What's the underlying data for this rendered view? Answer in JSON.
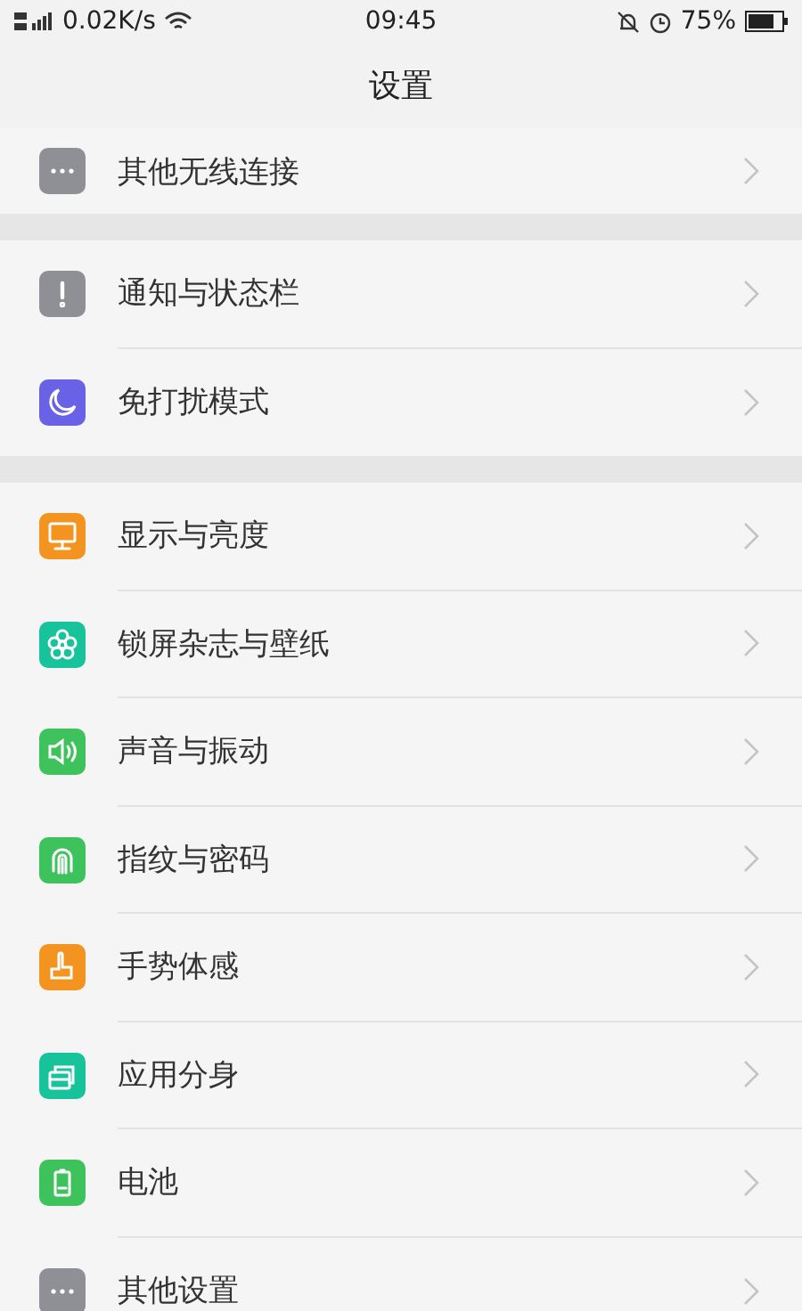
{
  "status_bar": {
    "network": "0.02K/s",
    "time": "09:45",
    "battery": "75%"
  },
  "title": "设置",
  "groups": [
    {
      "items": [
        {
          "label": "其他无线连接",
          "color": "#8e9095"
        }
      ]
    },
    {
      "items": [
        {
          "label": "通知与状态栏",
          "color": "#8e9095"
        },
        {
          "label": "免打扰模式",
          "color": "#6a62e6"
        }
      ]
    },
    {
      "items": [
        {
          "label": "显示与亮度",
          "color": "#f39320"
        },
        {
          "label": "锁屏杂志与壁纸",
          "color": "#17c39a"
        },
        {
          "label": "声音与振动",
          "color": "#3ec25c"
        },
        {
          "label": "指纹与密码",
          "color": "#3ec25c"
        },
        {
          "label": "手势体感",
          "color": "#f39320"
        },
        {
          "label": "应用分身",
          "color": "#17c39a"
        },
        {
          "label": "电池",
          "color": "#3ec25c"
        },
        {
          "label": "其他设置",
          "color": "#8e9095"
        }
      ]
    }
  ]
}
